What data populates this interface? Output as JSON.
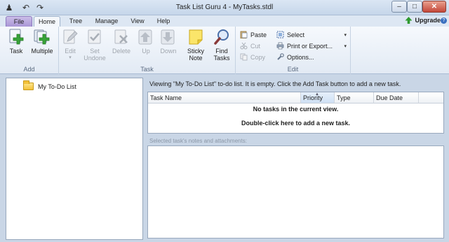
{
  "window": {
    "title": "Task List Guru 4 - MyTasks.stdl",
    "minimize_glyph": "–",
    "maximize_glyph": "□",
    "close_glyph": "✕"
  },
  "quick_access": [
    {
      "name": "app-menu-icon",
      "glyph": "♟"
    },
    {
      "name": "undo-icon",
      "glyph": "↶"
    },
    {
      "name": "redo-icon",
      "glyph": "↷"
    }
  ],
  "tabs": [
    "File",
    "Home",
    "Tree",
    "Manage",
    "View",
    "Help"
  ],
  "active_tab": "Home",
  "upgrade_label": "Upgrade",
  "help_glyph": "?",
  "ribbon": {
    "groups": {
      "add": {
        "label": "Add",
        "task": "Task",
        "multiple": "Multiple"
      },
      "task": {
        "label": "Task",
        "edit": "Edit",
        "set_undone": "Set\nUndone",
        "delete": "Delete",
        "up": "Up",
        "down": "Down",
        "sticky_note": "Sticky\nNote",
        "find_tasks": "Find\nTasks"
      },
      "edit": {
        "label": "Edit",
        "paste": "Paste",
        "cut": "Cut",
        "copy": "Copy",
        "select": "Select",
        "print_export": "Print or Export...",
        "options": "Options..."
      }
    }
  },
  "tree": {
    "items": [
      "My To-Do List"
    ]
  },
  "main": {
    "viewing_text": "Viewing \"My To-Do List\" to-do list. It is empty. Click the Add Task button to add a new task.",
    "columns": [
      "Task Name",
      "Priority",
      "Type",
      "Due Date"
    ],
    "sorted_column": "Priority",
    "empty_line1": "No tasks in the current view.",
    "empty_line2": "Double-click here to add a new task.",
    "notes_label": "Selected task's notes and attachments:"
  }
}
